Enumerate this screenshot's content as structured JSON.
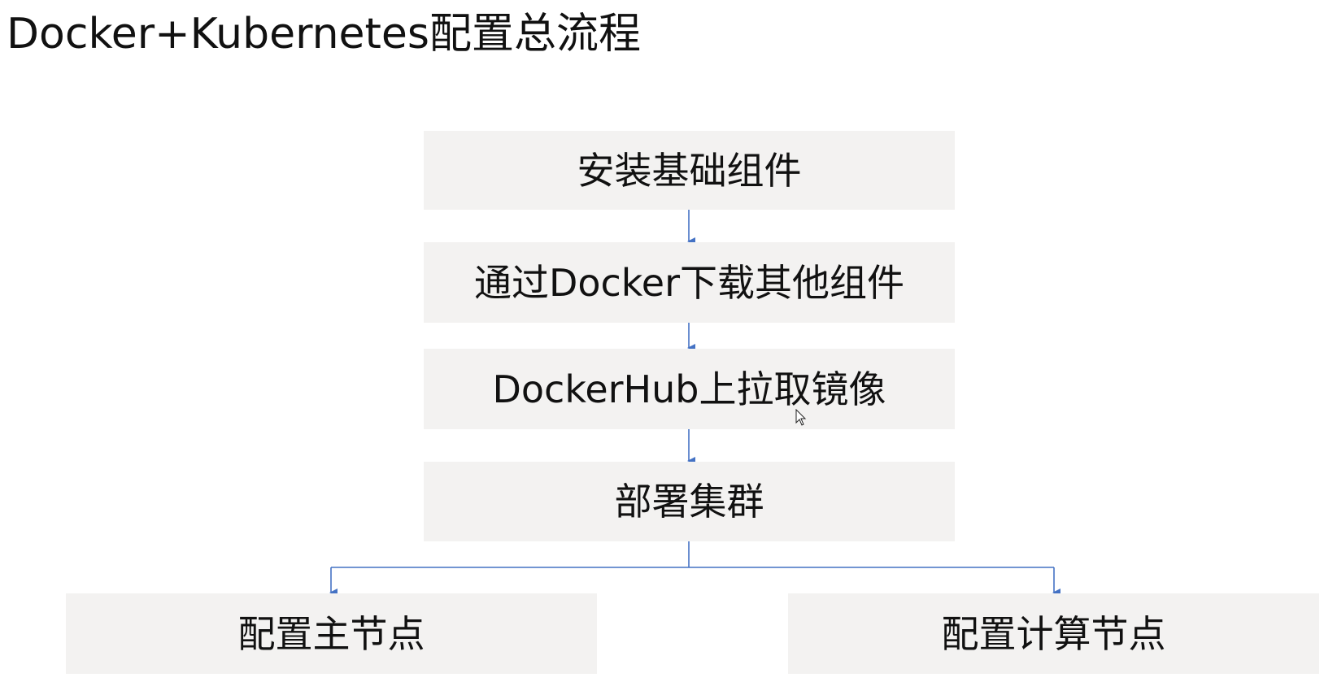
{
  "title": "Docker+Kubernetes配置总流程",
  "nodes": {
    "install": "安装基础组件",
    "download": "通过Docker下载其他组件",
    "pull": "DockerHub上拉取镜像",
    "deploy": "部署集群",
    "master": "配置主节点",
    "worker": "配置计算节点"
  },
  "colors": {
    "node_fill": "#f3f2f1",
    "connector": "#4472c4",
    "text": "#111111"
  },
  "icons": {
    "cursor": "mouse-pointer-icon"
  }
}
